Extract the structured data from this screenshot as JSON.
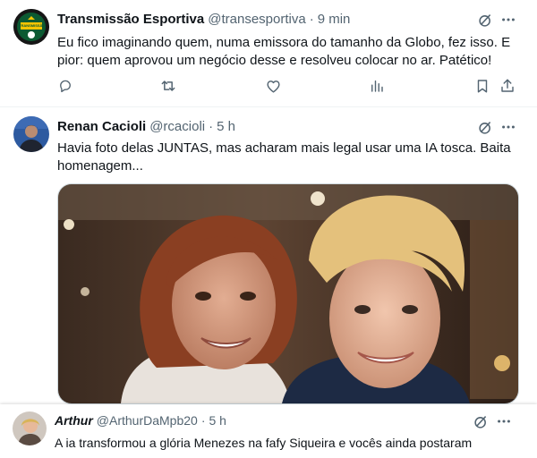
{
  "tweets": [
    {
      "author": "Transmissão Esportiva",
      "handle": "@transesportiva",
      "separator": "·",
      "time": "9 min",
      "text": "Eu fico imaginando quem, numa emissora do tamanho da Globo, fez isso. E pior: quem aprovou um negócio desse e resolveu colocar no ar. Patético!",
      "avatar_icon": "transmissao-logo-icon",
      "avatar_text": "TRANSMISSÃO"
    },
    {
      "author": "Renan Cacioli",
      "handle": "@rcacioli",
      "separator": "·",
      "time": "5 h",
      "text": "Havia foto delas JUNTAS, mas acharam mais legal usar uma IA tosca. Baita homenagem...",
      "avatar_icon": "profile-photo-icon"
    }
  ],
  "reply": {
    "author": "Arthur",
    "handle": "@ArthurDaMpb20",
    "separator": "·",
    "time": "5 h",
    "text": "A ia transformou a glória Menezes na fafy Siqueira e vocês ainda postaram"
  },
  "icons": {
    "grok": "grok-icon",
    "more": "more-icon",
    "reply": "reply-icon",
    "retweet": "retweet-icon",
    "like": "like-icon",
    "views": "views-icon",
    "bookmark": "bookmark-icon",
    "share": "share-icon"
  },
  "colors": {
    "text_primary": "#0f1419",
    "text_secondary": "#536471",
    "divider": "#eff3f4",
    "avatar_green": "#0c5a32"
  }
}
